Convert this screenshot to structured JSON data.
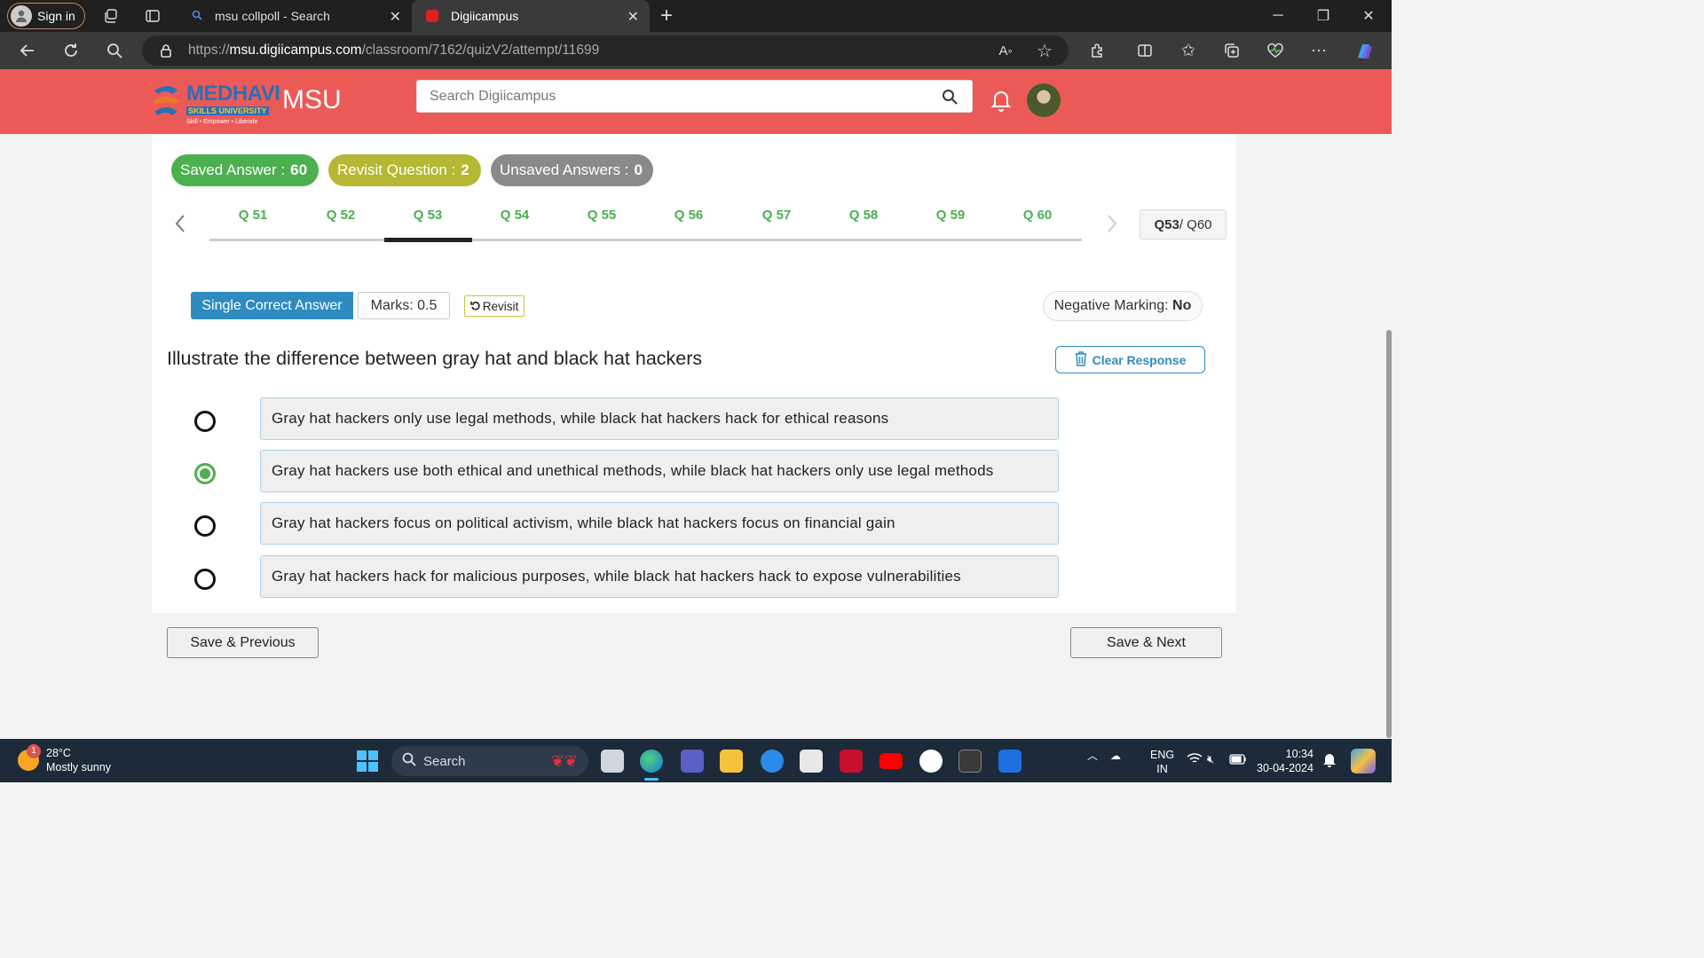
{
  "browser": {
    "signin_label": "Sign in",
    "tabs": [
      {
        "title": "msu collpoll - Search"
      },
      {
        "title": "Digiicampus"
      }
    ],
    "url_prefix": "https://",
    "url_host": "msu.digiicampus.com",
    "url_path": "/classroom/7162/quizV2/attempt/11699"
  },
  "site": {
    "brand_name": "MEDHAVI",
    "brand_sub": "SKILLS UNIVERSITY",
    "brand_tagline": "Skill • Empower • Liberate",
    "short_name": "MSU",
    "search_placeholder": "Search Digiicampus",
    "header_color": "#ec5a57"
  },
  "quiz": {
    "stats": {
      "saved_label": "Saved Answer :",
      "saved_value": "60",
      "revisit_label": "Revisit Question :",
      "revisit_value": "2",
      "unsaved_label": "Unsaved Answers :",
      "unsaved_value": "0"
    },
    "question_tabs": [
      "Q 51",
      "Q 52",
      "Q 53",
      "Q 54",
      "Q 55",
      "Q 56",
      "Q 57",
      "Q 58",
      "Q 59",
      "Q 60"
    ],
    "active_tab": "Q 53",
    "counter_current": "Q53",
    "counter_total": " / Q60",
    "type_label": "Single Correct Answer",
    "marks_label": "Marks: 0.5",
    "revisit_button": "Revisit",
    "negative_label": "Negative Marking:",
    "negative_value": "No",
    "question_text": "Illustrate the difference between gray hat and black hat hackers",
    "clear_label": "Clear Response",
    "options": [
      {
        "text": "Gray hat hackers only use legal methods, while black hat hackers hack for ethical reasons",
        "selected": false
      },
      {
        "text": "Gray hat hackers use both ethical and unethical methods, while black hat hackers only use legal methods",
        "selected": true
      },
      {
        "text": "Gray hat hackers focus on political activism, while black hat hackers focus on financial gain",
        "selected": false
      },
      {
        "text": "Gray hat hackers hack for malicious purposes, while black hat hackers hack to expose vulnerabilities",
        "selected": false
      }
    ],
    "prev_button": "Save & Previous",
    "next_button": "Save & Next",
    "colors": {
      "green": "#4caf50",
      "olive": "#b5b832",
      "gray": "#8a8a8a",
      "blue": "#2e8bc0"
    }
  },
  "taskbar": {
    "weather_badge": "1",
    "temperature": "28°C",
    "weather_text": "Mostly sunny",
    "search_label": "Search",
    "lang_line1": "ENG",
    "lang_line2": "IN",
    "time": "10:34",
    "date": "30-04-2024"
  }
}
